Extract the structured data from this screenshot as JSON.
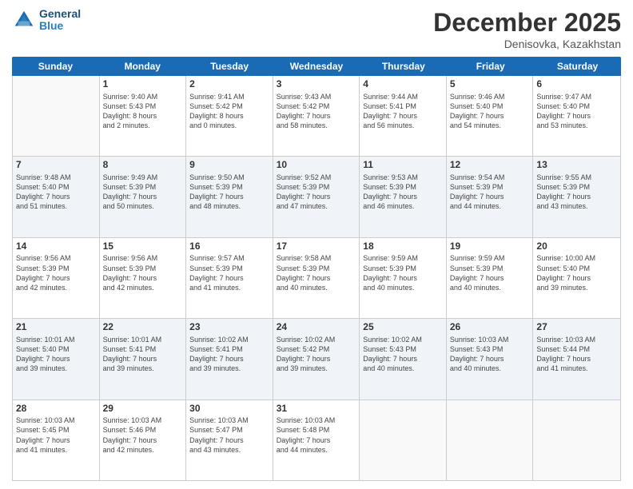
{
  "header": {
    "logo_line1": "General",
    "logo_line2": "Blue",
    "month": "December 2025",
    "location": "Denisovka, Kazakhstan"
  },
  "weekdays": [
    "Sunday",
    "Monday",
    "Tuesday",
    "Wednesday",
    "Thursday",
    "Friday",
    "Saturday"
  ],
  "rows": [
    [
      {
        "day": "",
        "info": ""
      },
      {
        "day": "1",
        "info": "Sunrise: 9:40 AM\nSunset: 5:43 PM\nDaylight: 8 hours\nand 2 minutes."
      },
      {
        "day": "2",
        "info": "Sunrise: 9:41 AM\nSunset: 5:42 PM\nDaylight: 8 hours\nand 0 minutes."
      },
      {
        "day": "3",
        "info": "Sunrise: 9:43 AM\nSunset: 5:42 PM\nDaylight: 7 hours\nand 58 minutes."
      },
      {
        "day": "4",
        "info": "Sunrise: 9:44 AM\nSunset: 5:41 PM\nDaylight: 7 hours\nand 56 minutes."
      },
      {
        "day": "5",
        "info": "Sunrise: 9:46 AM\nSunset: 5:40 PM\nDaylight: 7 hours\nand 54 minutes."
      },
      {
        "day": "6",
        "info": "Sunrise: 9:47 AM\nSunset: 5:40 PM\nDaylight: 7 hours\nand 53 minutes."
      }
    ],
    [
      {
        "day": "7",
        "info": "Sunrise: 9:48 AM\nSunset: 5:40 PM\nDaylight: 7 hours\nand 51 minutes."
      },
      {
        "day": "8",
        "info": "Sunrise: 9:49 AM\nSunset: 5:39 PM\nDaylight: 7 hours\nand 50 minutes."
      },
      {
        "day": "9",
        "info": "Sunrise: 9:50 AM\nSunset: 5:39 PM\nDaylight: 7 hours\nand 48 minutes."
      },
      {
        "day": "10",
        "info": "Sunrise: 9:52 AM\nSunset: 5:39 PM\nDaylight: 7 hours\nand 47 minutes."
      },
      {
        "day": "11",
        "info": "Sunrise: 9:53 AM\nSunset: 5:39 PM\nDaylight: 7 hours\nand 46 minutes."
      },
      {
        "day": "12",
        "info": "Sunrise: 9:54 AM\nSunset: 5:39 PM\nDaylight: 7 hours\nand 44 minutes."
      },
      {
        "day": "13",
        "info": "Sunrise: 9:55 AM\nSunset: 5:39 PM\nDaylight: 7 hours\nand 43 minutes."
      }
    ],
    [
      {
        "day": "14",
        "info": "Sunrise: 9:56 AM\nSunset: 5:39 PM\nDaylight: 7 hours\nand 42 minutes."
      },
      {
        "day": "15",
        "info": "Sunrise: 9:56 AM\nSunset: 5:39 PM\nDaylight: 7 hours\nand 42 minutes."
      },
      {
        "day": "16",
        "info": "Sunrise: 9:57 AM\nSunset: 5:39 PM\nDaylight: 7 hours\nand 41 minutes."
      },
      {
        "day": "17",
        "info": "Sunrise: 9:58 AM\nSunset: 5:39 PM\nDaylight: 7 hours\nand 40 minutes."
      },
      {
        "day": "18",
        "info": "Sunrise: 9:59 AM\nSunset: 5:39 PM\nDaylight: 7 hours\nand 40 minutes."
      },
      {
        "day": "19",
        "info": "Sunrise: 9:59 AM\nSunset: 5:39 PM\nDaylight: 7 hours\nand 40 minutes."
      },
      {
        "day": "20",
        "info": "Sunrise: 10:00 AM\nSunset: 5:40 PM\nDaylight: 7 hours\nand 39 minutes."
      }
    ],
    [
      {
        "day": "21",
        "info": "Sunrise: 10:01 AM\nSunset: 5:40 PM\nDaylight: 7 hours\nand 39 minutes."
      },
      {
        "day": "22",
        "info": "Sunrise: 10:01 AM\nSunset: 5:41 PM\nDaylight: 7 hours\nand 39 minutes."
      },
      {
        "day": "23",
        "info": "Sunrise: 10:02 AM\nSunset: 5:41 PM\nDaylight: 7 hours\nand 39 minutes."
      },
      {
        "day": "24",
        "info": "Sunrise: 10:02 AM\nSunset: 5:42 PM\nDaylight: 7 hours\nand 39 minutes."
      },
      {
        "day": "25",
        "info": "Sunrise: 10:02 AM\nSunset: 5:43 PM\nDaylight: 7 hours\nand 40 minutes."
      },
      {
        "day": "26",
        "info": "Sunrise: 10:03 AM\nSunset: 5:43 PM\nDaylight: 7 hours\nand 40 minutes."
      },
      {
        "day": "27",
        "info": "Sunrise: 10:03 AM\nSunset: 5:44 PM\nDaylight: 7 hours\nand 41 minutes."
      }
    ],
    [
      {
        "day": "28",
        "info": "Sunrise: 10:03 AM\nSunset: 5:45 PM\nDaylight: 7 hours\nand 41 minutes."
      },
      {
        "day": "29",
        "info": "Sunrise: 10:03 AM\nSunset: 5:46 PM\nDaylight: 7 hours\nand 42 minutes."
      },
      {
        "day": "30",
        "info": "Sunrise: 10:03 AM\nSunset: 5:47 PM\nDaylight: 7 hours\nand 43 minutes."
      },
      {
        "day": "31",
        "info": "Sunrise: 10:03 AM\nSunset: 5:48 PM\nDaylight: 7 hours\nand 44 minutes."
      },
      {
        "day": "",
        "info": ""
      },
      {
        "day": "",
        "info": ""
      },
      {
        "day": "",
        "info": ""
      }
    ]
  ]
}
